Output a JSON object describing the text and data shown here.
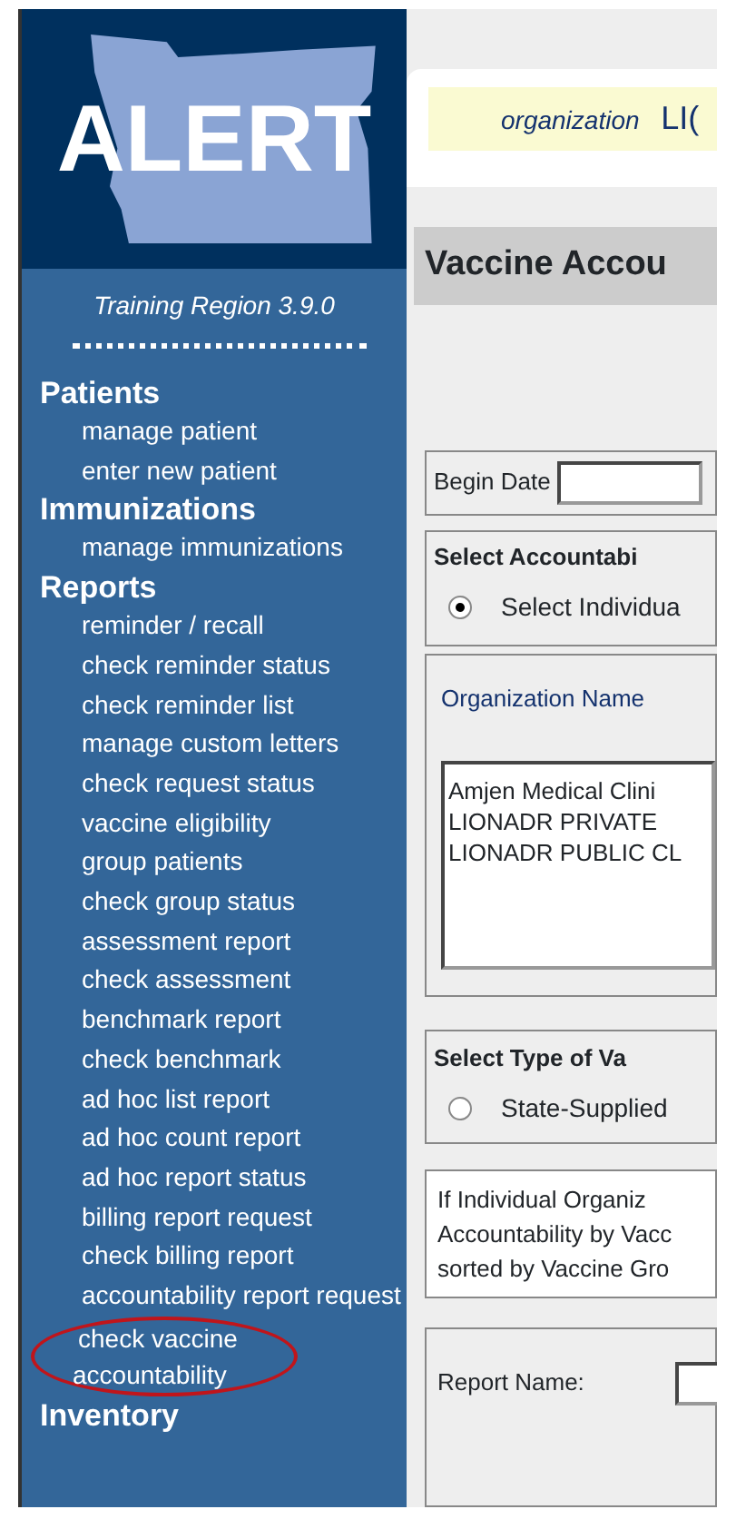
{
  "logo": {
    "text": "ALERT"
  },
  "region": "Training Region 3.9.0",
  "menu": [
    {
      "label": "Patients",
      "items": [
        {
          "label": "manage patient",
          "highlighted": false
        },
        {
          "label": "enter new patient",
          "highlighted": false
        }
      ]
    },
    {
      "label": "Immunizations",
      "items": [
        {
          "label": "manage immunizations",
          "highlighted": false
        }
      ]
    },
    {
      "label": "Reports",
      "items": [
        {
          "label": "reminder / recall",
          "highlighted": false
        },
        {
          "label": "check reminder status",
          "highlighted": false
        },
        {
          "label": "check reminder list",
          "highlighted": false
        },
        {
          "label": "manage custom letters",
          "highlighted": false
        },
        {
          "label": "check request status",
          "highlighted": false
        },
        {
          "label": "vaccine eligibility",
          "highlighted": false
        },
        {
          "label": "group patients",
          "highlighted": false
        },
        {
          "label": "check group status",
          "highlighted": false
        },
        {
          "label": "assessment report",
          "highlighted": false
        },
        {
          "label": "check assessment",
          "highlighted": false
        },
        {
          "label": "benchmark report",
          "highlighted": false
        },
        {
          "label": "check benchmark",
          "highlighted": false
        },
        {
          "label": "ad hoc list report",
          "highlighted": false
        },
        {
          "label": "ad hoc count report",
          "highlighted": false
        },
        {
          "label": "ad hoc report status",
          "highlighted": false
        },
        {
          "label": "billing report request",
          "highlighted": false
        },
        {
          "label": "check billing report",
          "highlighted": false
        },
        {
          "label": "accountability report request",
          "highlighted": false
        },
        {
          "label": "check vaccine accountability",
          "highlighted": true
        }
      ]
    },
    {
      "label": "Inventory"
    }
  ],
  "org_bar": {
    "label": "organization",
    "value": "LI("
  },
  "page_title": "Vaccine Accou",
  "begin_date": {
    "label": "Begin Date"
  },
  "accountability": {
    "heading": "Select Accountabi",
    "option": {
      "label": "Select Individua",
      "checked": true
    }
  },
  "organizations": {
    "label": "Organization Name",
    "items": [
      "Amjen Medical Clini",
      "LIONADR PRIVATE",
      "LIONADR PUBLIC CL"
    ]
  },
  "vaccine_type": {
    "heading": "Select Type of Va",
    "option": {
      "label": "State-Supplied",
      "checked": false
    }
  },
  "info_lines": [
    "If Individual Organiz",
    "Accountability by Vacc",
    "sorted by Vaccine Gro"
  ],
  "report_name": {
    "label": "Report Name:"
  }
}
